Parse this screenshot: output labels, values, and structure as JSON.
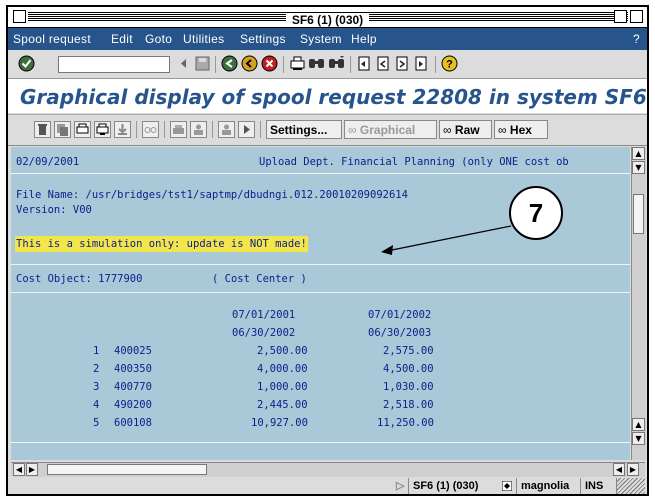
{
  "window": {
    "title": "SF6 (1) (030)"
  },
  "menubar": {
    "items": [
      "Spool request",
      "Edit",
      "Goto",
      "Utilities",
      "Settings",
      "System",
      "Help"
    ],
    "help_mark": "?"
  },
  "stdbar": {
    "command_value": "",
    "icons": [
      "enter-icon",
      "back-nav-icon",
      "save-icon",
      "back-icon",
      "exit-icon",
      "cancel-icon",
      "print-icon",
      "find-icon",
      "find-next-icon",
      "first-page-icon",
      "previous-page-icon",
      "next-page-icon",
      "last-page-icon",
      "help-icon"
    ]
  },
  "page_title": "Graphical display of spool request 22808 in system SF6",
  "appbar": {
    "settings_label": "Settings...",
    "graphical_label": "Graphical",
    "raw_label": "Raw",
    "hex_label": "Hex"
  },
  "content": {
    "date_line": "02/09/2001",
    "header_right": "Upload Dept. Financial Planning (only ONE cost ob",
    "file_name": "File Name: /usr/bridges/tst1/saptmp/dbudngi.012.20010209092614",
    "version": "Version: V00",
    "simulation_notice": "This is a simulation only: update is NOT made!",
    "cost_object": "Cost Object: 1777900",
    "cost_center": "( Cost Center )",
    "period1_from": "07/01/2001",
    "period1_to": "06/30/2002",
    "period2_from": "07/01/2002",
    "period2_to": "06/30/2003",
    "rows": [
      {
        "num": "1",
        "account": "400025",
        "amount1": "2,500.00",
        "amount2": "2,575.00"
      },
      {
        "num": "2",
        "account": "400350",
        "amount1": "4,000.00",
        "amount2": "4,500.00"
      },
      {
        "num": "3",
        "account": "400770",
        "amount1": "1,000.00",
        "amount2": "1,030.00"
      },
      {
        "num": "4",
        "account": "490200",
        "amount1": "2,445.00",
        "amount2": "2,518.00"
      },
      {
        "num": "5",
        "account": "600108",
        "amount1": "10,927.00",
        "amount2": "11,250.00"
      }
    ]
  },
  "statusbar": {
    "session": "SF6 (1) (030)",
    "server": "magnolia",
    "mode": "INS"
  },
  "callout": {
    "number": "7"
  },
  "colors": {
    "menubar": "#27548a",
    "title_text": "#27548a",
    "content_bg": "#a9c8d8",
    "content_text": "#10208a",
    "highlight": "#f2e64a"
  }
}
